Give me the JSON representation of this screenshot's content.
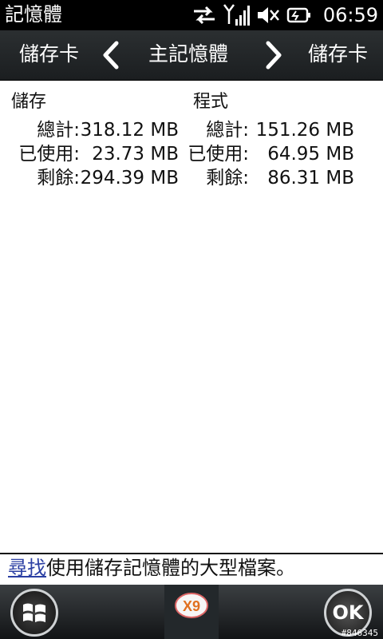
{
  "status_bar": {
    "app_title": "記憶體",
    "time": "06:59",
    "icons": [
      "data-sync-icon",
      "signal-icon",
      "volume-muted-icon",
      "battery-charging-icon"
    ]
  },
  "tabs": {
    "left": "儲存卡",
    "current": "主記憶體",
    "right": "儲存卡"
  },
  "storage": {
    "title": "儲存",
    "rows": [
      {
        "label": "總計:",
        "value": "318.12 MB"
      },
      {
        "label": "已使用:",
        "value": "23.73 MB"
      },
      {
        "label": "剩餘:",
        "value": "294.39 MB"
      }
    ]
  },
  "program": {
    "title": "程式",
    "rows": [
      {
        "label": "總計:",
        "value": "151.26 MB"
      },
      {
        "label": "已使用:",
        "value": "64.95 MB"
      },
      {
        "label": "剩餘:",
        "value": "86.31 MB"
      }
    ]
  },
  "hint": {
    "link": "尋找",
    "text": "使用儲存記憶體的大型檔案。"
  },
  "softkeys": {
    "start_icon": "windows-flag-icon",
    "center_icon": "x9-app-icon",
    "center_label": "X9",
    "ok_label": "OK"
  },
  "watermark": "#846345"
}
